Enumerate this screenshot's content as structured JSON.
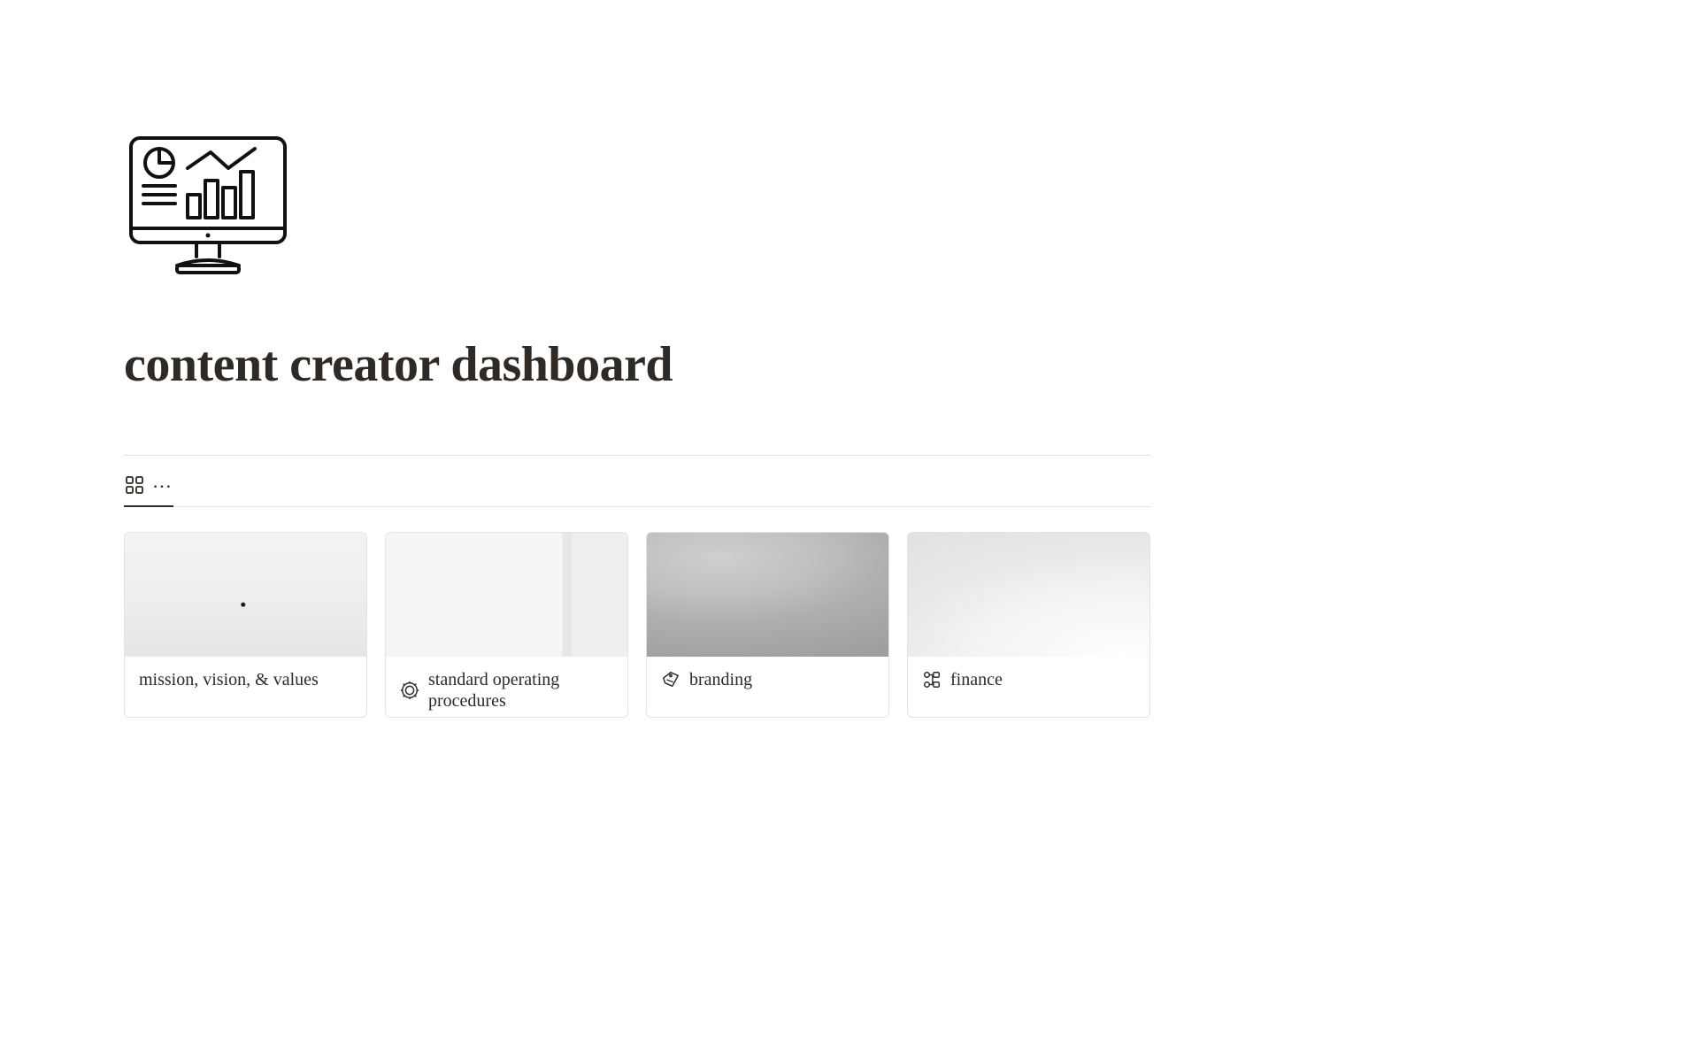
{
  "page": {
    "title": "content creator dashboard"
  },
  "views": {
    "gallery_icon": "gallery",
    "more": "…"
  },
  "cards": [
    {
      "title": "mission, vision, & values",
      "icon": null
    },
    {
      "title": "standard operating procedures",
      "icon": "sop"
    },
    {
      "title": "branding",
      "icon": "brand-tag"
    },
    {
      "title": "finance",
      "icon": "finance-nodes"
    }
  ]
}
